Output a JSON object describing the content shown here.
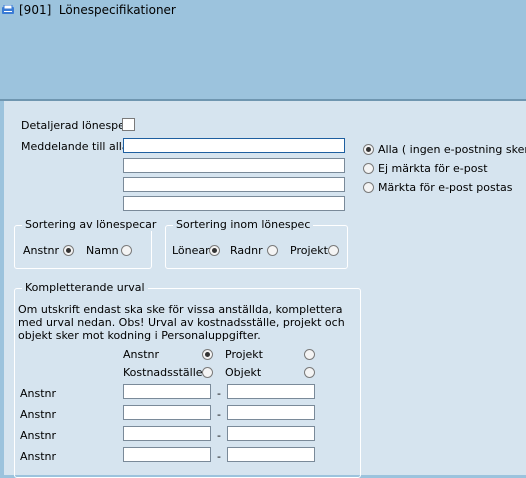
{
  "window": {
    "id": "[901]",
    "title": "Lönespecifikationer"
  },
  "detailed": {
    "label": "Detaljerad lönespec",
    "checked": false
  },
  "message": {
    "label": "Meddelande till alla",
    "lines": [
      "",
      "",
      "",
      ""
    ]
  },
  "delivery": {
    "options": [
      "Alla ( ingen e-postning sker )",
      "Ej märkta för e-post",
      "Märkta för e-post postas"
    ],
    "selected": 0
  },
  "sort_specs": {
    "legend": "Sortering av lönespecar",
    "opt1": "Anstnr",
    "opt2": "Namn",
    "selected": "Anstnr"
  },
  "sort_within": {
    "legend": "Sortering inom lönespec",
    "opt1": "Löneart",
    "opt2": "Radnr",
    "opt3": "Projekt",
    "selected": "Löneart"
  },
  "selection": {
    "legend": "Kompletterande urval",
    "description": "Om utskrift endast ska ske för vissa anställda, komplettera med urval nedan. Obs! Urval av kostnadsställe, projekt och objekt sker mot kodning i Personaluppgifter.",
    "opt_anstnr": "Anstnr",
    "opt_kst": "Kostnadsställe",
    "opt_projekt": "Projekt",
    "opt_objekt": "Objekt",
    "selected": "Anstnr",
    "range_label": "Anstnr",
    "dash": "-"
  }
}
